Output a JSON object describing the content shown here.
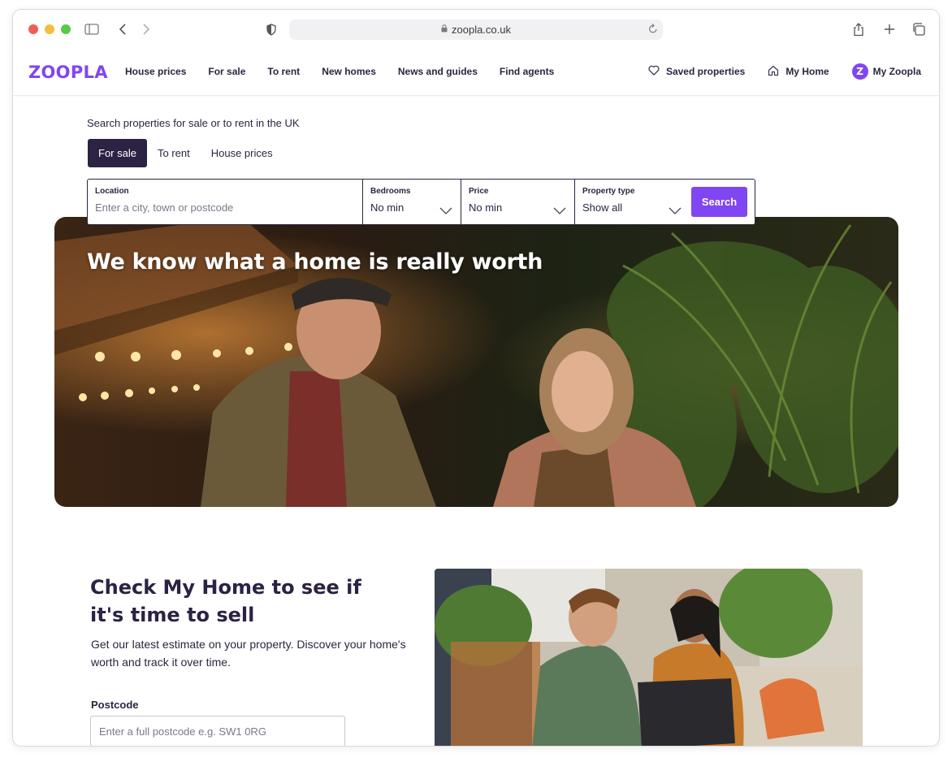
{
  "browser": {
    "url": "zoopla.co.uk"
  },
  "nav": {
    "logo": "ZOOPLA",
    "links": [
      "House prices",
      "For sale",
      "To rent",
      "New homes",
      "News and guides",
      "Find agents"
    ],
    "saved": "Saved properties",
    "my_home": "My Home",
    "my_zoopla": "My Zoopla",
    "badge_letter": "Z"
  },
  "search": {
    "intro": "Search properties for sale or to rent in the UK",
    "tabs": [
      "For sale",
      "To rent",
      "House prices"
    ],
    "active_tab": "For sale",
    "location_label": "Location",
    "location_placeholder": "Enter a city, town or postcode",
    "bedrooms_label": "Bedrooms",
    "bedrooms_value": "No min",
    "price_label": "Price",
    "price_value": "No min",
    "type_label": "Property type",
    "type_value": "Show all",
    "button": "Search"
  },
  "hero": {
    "headline": "We know what a home is really worth"
  },
  "check_my_home": {
    "title": "Check My Home to see if it's time to sell",
    "description": "Get our latest estimate on your property. Discover your home's worth and track it over time.",
    "postcode_label": "Postcode",
    "postcode_placeholder": "Enter a full postcode e.g. SW1 0RG"
  },
  "colors": {
    "brand_purple": "#8046f1",
    "dark_tab": "#2b2244"
  }
}
